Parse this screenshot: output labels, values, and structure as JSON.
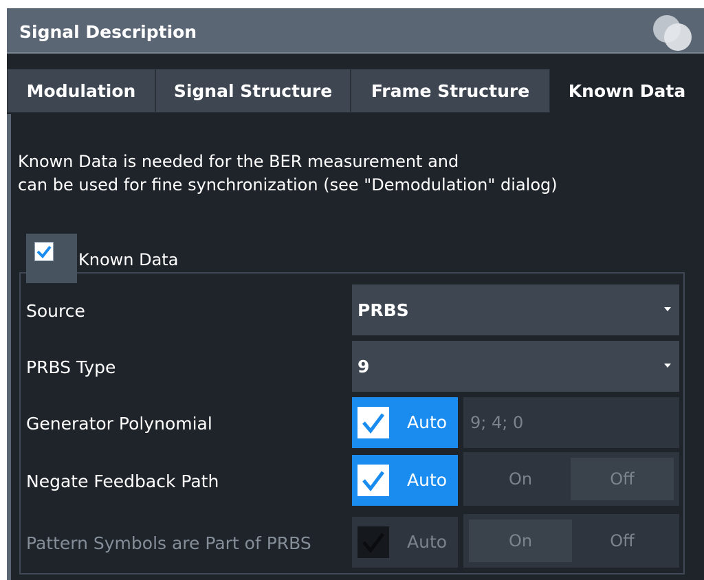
{
  "dialog": {
    "title": "Signal Description"
  },
  "tabs": [
    {
      "label": "Modulation"
    },
    {
      "label": "Signal Structure"
    },
    {
      "label": "Frame Structure"
    },
    {
      "label": "Known Data",
      "active": true
    }
  ],
  "description": {
    "line1": "Known Data is needed for the BER measurement and",
    "line2": "can be used for fine synchronization (see \"Demodulation\" dialog)"
  },
  "known_data": {
    "label": "Known Data",
    "checked": true
  },
  "rows": {
    "source": {
      "label": "Source",
      "value": "PRBS"
    },
    "prbs_type": {
      "label": "PRBS Type",
      "value": "9"
    },
    "generator_polynomial": {
      "label": "Generator Polynomial",
      "auto_label": "Auto",
      "auto_checked": true,
      "value": "9; 4; 0"
    },
    "negate_feedback": {
      "label": "Negate Feedback Path",
      "auto_label": "Auto",
      "auto_checked": true,
      "on_label": "On",
      "off_label": "Off",
      "selected": "Off"
    },
    "pattern_symbols": {
      "label": "Pattern Symbols are Part of PRBS",
      "auto_label": "Auto",
      "auto_checked": true,
      "on_label": "On",
      "off_label": "Off",
      "selected": "On",
      "enabled": false
    }
  },
  "colors": {
    "accent": "#1a8cf0",
    "check": "#1a8cf0",
    "background": "#1f242b",
    "titlebar": "#5b6675"
  }
}
